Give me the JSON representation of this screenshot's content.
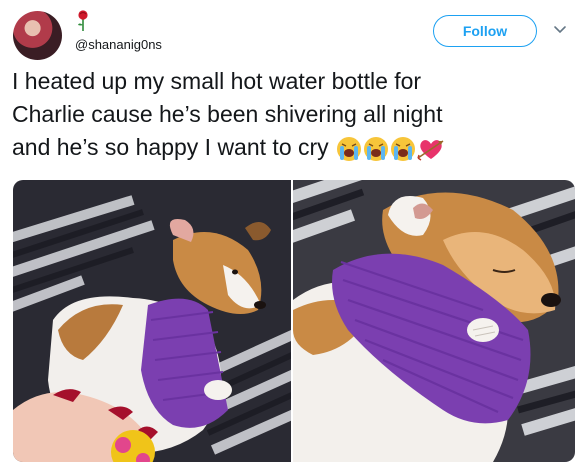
{
  "user": {
    "handle": "@shananig0ns"
  },
  "follow": {
    "label": "Follow"
  },
  "tweet": {
    "text": "I heated up my small hot water bottle for\nCharlie cause he’s been shivering all night\nand he’s so happy I want to cry",
    "emojis": [
      "loudly-crying-face",
      "loudly-crying-face",
      "loudly-crying-face",
      "heart-with-arrow"
    ]
  },
  "media": {
    "count": 2
  },
  "colors": {
    "accent": "#1da1f2",
    "text": "#14171a",
    "bottle": "#7b3fb0"
  }
}
